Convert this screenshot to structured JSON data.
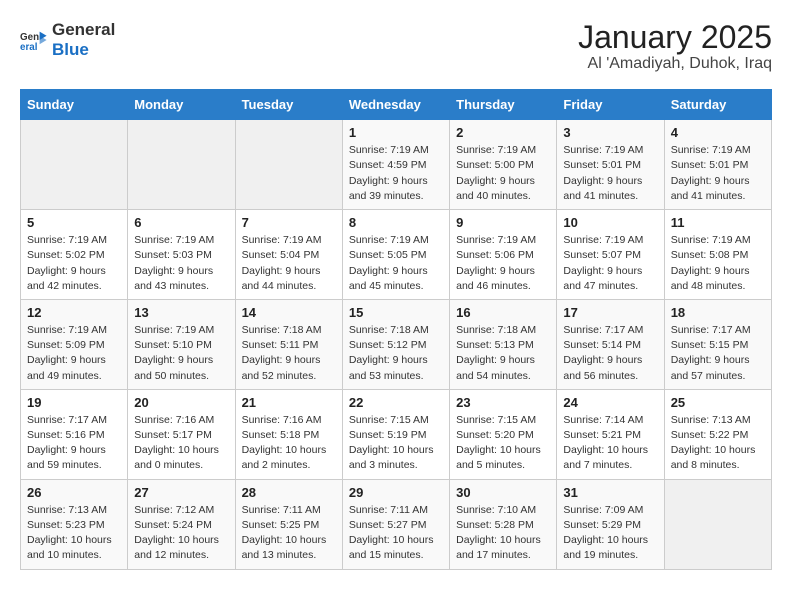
{
  "logo": {
    "line1": "General",
    "line2": "Blue"
  },
  "calendar": {
    "title": "January 2025",
    "subtitle": "Al 'Amadiyah, Duhok, Iraq",
    "headers": [
      "Sunday",
      "Monday",
      "Tuesday",
      "Wednesday",
      "Thursday",
      "Friday",
      "Saturday"
    ],
    "weeks": [
      [
        {
          "day": "",
          "info": ""
        },
        {
          "day": "",
          "info": ""
        },
        {
          "day": "",
          "info": ""
        },
        {
          "day": "1",
          "info": "Sunrise: 7:19 AM\nSunset: 4:59 PM\nDaylight: 9 hours\nand 39 minutes."
        },
        {
          "day": "2",
          "info": "Sunrise: 7:19 AM\nSunset: 5:00 PM\nDaylight: 9 hours\nand 40 minutes."
        },
        {
          "day": "3",
          "info": "Sunrise: 7:19 AM\nSunset: 5:01 PM\nDaylight: 9 hours\nand 41 minutes."
        },
        {
          "day": "4",
          "info": "Sunrise: 7:19 AM\nSunset: 5:01 PM\nDaylight: 9 hours\nand 41 minutes."
        }
      ],
      [
        {
          "day": "5",
          "info": "Sunrise: 7:19 AM\nSunset: 5:02 PM\nDaylight: 9 hours\nand 42 minutes."
        },
        {
          "day": "6",
          "info": "Sunrise: 7:19 AM\nSunset: 5:03 PM\nDaylight: 9 hours\nand 43 minutes."
        },
        {
          "day": "7",
          "info": "Sunrise: 7:19 AM\nSunset: 5:04 PM\nDaylight: 9 hours\nand 44 minutes."
        },
        {
          "day": "8",
          "info": "Sunrise: 7:19 AM\nSunset: 5:05 PM\nDaylight: 9 hours\nand 45 minutes."
        },
        {
          "day": "9",
          "info": "Sunrise: 7:19 AM\nSunset: 5:06 PM\nDaylight: 9 hours\nand 46 minutes."
        },
        {
          "day": "10",
          "info": "Sunrise: 7:19 AM\nSunset: 5:07 PM\nDaylight: 9 hours\nand 47 minutes."
        },
        {
          "day": "11",
          "info": "Sunrise: 7:19 AM\nSunset: 5:08 PM\nDaylight: 9 hours\nand 48 minutes."
        }
      ],
      [
        {
          "day": "12",
          "info": "Sunrise: 7:19 AM\nSunset: 5:09 PM\nDaylight: 9 hours\nand 49 minutes."
        },
        {
          "day": "13",
          "info": "Sunrise: 7:19 AM\nSunset: 5:10 PM\nDaylight: 9 hours\nand 50 minutes."
        },
        {
          "day": "14",
          "info": "Sunrise: 7:18 AM\nSunset: 5:11 PM\nDaylight: 9 hours\nand 52 minutes."
        },
        {
          "day": "15",
          "info": "Sunrise: 7:18 AM\nSunset: 5:12 PM\nDaylight: 9 hours\nand 53 minutes."
        },
        {
          "day": "16",
          "info": "Sunrise: 7:18 AM\nSunset: 5:13 PM\nDaylight: 9 hours\nand 54 minutes."
        },
        {
          "day": "17",
          "info": "Sunrise: 7:17 AM\nSunset: 5:14 PM\nDaylight: 9 hours\nand 56 minutes."
        },
        {
          "day": "18",
          "info": "Sunrise: 7:17 AM\nSunset: 5:15 PM\nDaylight: 9 hours\nand 57 minutes."
        }
      ],
      [
        {
          "day": "19",
          "info": "Sunrise: 7:17 AM\nSunset: 5:16 PM\nDaylight: 9 hours\nand 59 minutes."
        },
        {
          "day": "20",
          "info": "Sunrise: 7:16 AM\nSunset: 5:17 PM\nDaylight: 10 hours\nand 0 minutes."
        },
        {
          "day": "21",
          "info": "Sunrise: 7:16 AM\nSunset: 5:18 PM\nDaylight: 10 hours\nand 2 minutes."
        },
        {
          "day": "22",
          "info": "Sunrise: 7:15 AM\nSunset: 5:19 PM\nDaylight: 10 hours\nand 3 minutes."
        },
        {
          "day": "23",
          "info": "Sunrise: 7:15 AM\nSunset: 5:20 PM\nDaylight: 10 hours\nand 5 minutes."
        },
        {
          "day": "24",
          "info": "Sunrise: 7:14 AM\nSunset: 5:21 PM\nDaylight: 10 hours\nand 7 minutes."
        },
        {
          "day": "25",
          "info": "Sunrise: 7:13 AM\nSunset: 5:22 PM\nDaylight: 10 hours\nand 8 minutes."
        }
      ],
      [
        {
          "day": "26",
          "info": "Sunrise: 7:13 AM\nSunset: 5:23 PM\nDaylight: 10 hours\nand 10 minutes."
        },
        {
          "day": "27",
          "info": "Sunrise: 7:12 AM\nSunset: 5:24 PM\nDaylight: 10 hours\nand 12 minutes."
        },
        {
          "day": "28",
          "info": "Sunrise: 7:11 AM\nSunset: 5:25 PM\nDaylight: 10 hours\nand 13 minutes."
        },
        {
          "day": "29",
          "info": "Sunrise: 7:11 AM\nSunset: 5:27 PM\nDaylight: 10 hours\nand 15 minutes."
        },
        {
          "day": "30",
          "info": "Sunrise: 7:10 AM\nSunset: 5:28 PM\nDaylight: 10 hours\nand 17 minutes."
        },
        {
          "day": "31",
          "info": "Sunrise: 7:09 AM\nSunset: 5:29 PM\nDaylight: 10 hours\nand 19 minutes."
        },
        {
          "day": "",
          "info": ""
        }
      ]
    ]
  }
}
